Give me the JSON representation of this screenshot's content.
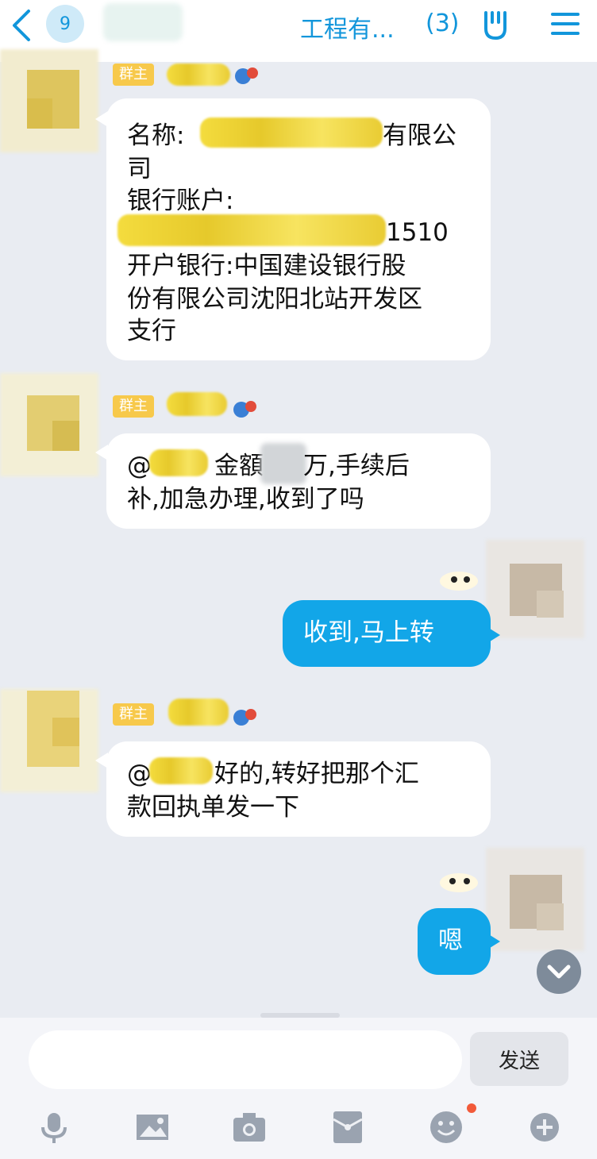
{
  "header": {
    "unread_count": "9",
    "title": "工程有...",
    "member_count": "(3)"
  },
  "messages": [
    {
      "sender_tag": "群主",
      "lines": [
        "名称:",
        "有限公",
        "司",
        "银行账户:",
        "1510",
        "开户银行:中国建设银行股",
        "份有限公司沈阳北站开发区",
        "支行"
      ]
    },
    {
      "sender_tag": "群主",
      "line1_a": "@",
      "line1_b": "金額",
      "line1_c": "万,手续后",
      "line2": "补,加急办理,收到了吗"
    },
    {
      "text": "收到,马上转"
    },
    {
      "sender_tag": "群主",
      "line1_a": "@",
      "line1_b": "好的,转好把那个汇",
      "line2": "款回执单发一下"
    },
    {
      "text": "嗯"
    }
  ],
  "input": {
    "send_label": "发送"
  },
  "toolbar": {
    "icons": [
      "microphone-icon",
      "image-icon",
      "camera-icon",
      "red-packet-icon",
      "emoji-icon",
      "plus-icon"
    ],
    "notification_dot_color": "#f25a3a"
  },
  "colors": {
    "accent": "#1296db",
    "bubble_self": "#12a6e8",
    "owner_tag": "#f7c94b"
  }
}
